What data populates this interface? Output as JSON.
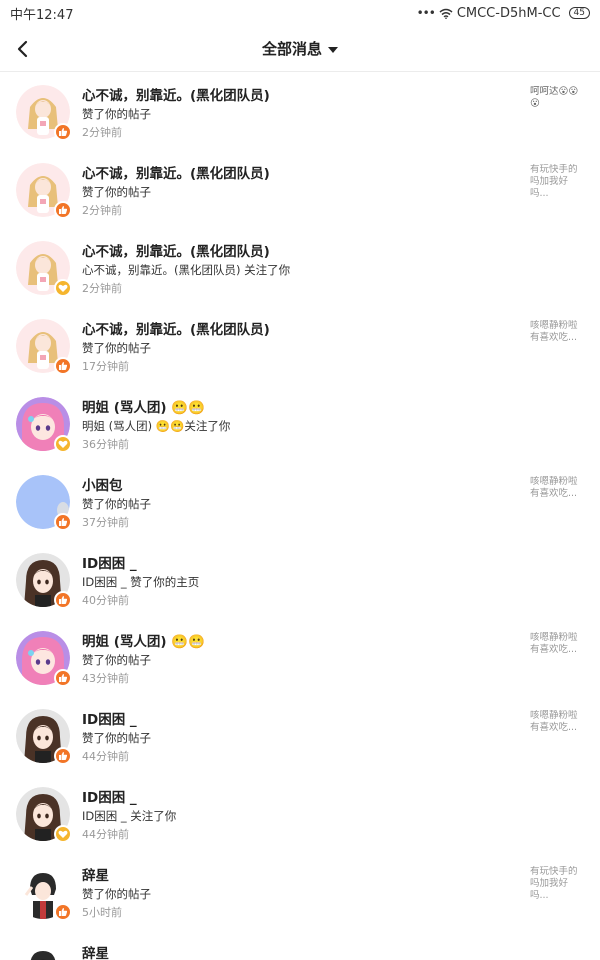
{
  "status_bar": {
    "time": "中午12:47",
    "carrier": "CMCC-D5hM-CC",
    "battery": "45"
  },
  "header": {
    "title": "全部消息"
  },
  "notifications": [
    {
      "name": "心不诚，别靠近。(黑化团队员)",
      "action": "赞了你的帖子",
      "time": "2分钟前",
      "preview": "呵呵达😮😮😮",
      "badge": "like",
      "avatar": "anime-girl-blonde"
    },
    {
      "name": "心不诚，别靠近。(黑化团队员)",
      "action": "赞了你的帖子",
      "time": "2分钟前",
      "preview": "有玩快手的吗加我好吗...",
      "badge": "like",
      "avatar": "anime-girl-blonde"
    },
    {
      "name": "心不诚，别靠近。(黑化团队员)",
      "action": "心不诚，别靠近。(黑化团队员) 关注了你",
      "time": "2分钟前",
      "preview": "",
      "badge": "follow",
      "avatar": "anime-girl-blonde"
    },
    {
      "name": "心不诚，别靠近。(黑化团队员)",
      "action": "赞了你的帖子",
      "time": "17分钟前",
      "preview": "咳嗯静粉啦有喜欢吃...",
      "badge": "like",
      "avatar": "anime-girl-blonde"
    },
    {
      "name": "明姐 (骂人团) 😬😬",
      "action": "明姐 (骂人团) 😬😬关注了你",
      "time": "36分钟前",
      "preview": "",
      "badge": "follow",
      "avatar": "anime-girl-pink"
    },
    {
      "name": "小困包",
      "action": "赞了你的帖子",
      "time": "37分钟前",
      "preview": "咳嗯静粉啦有喜欢吃...",
      "badge": "like",
      "avatar": "blue-circle"
    },
    {
      "name": "ID困困 _",
      "action": "ID困困 _ 赞了你的主页",
      "time": "40分钟前",
      "preview": "",
      "badge": "like",
      "avatar": "anime-girl-brown"
    },
    {
      "name": "明姐 (骂人团) 😬😬",
      "action": "赞了你的帖子",
      "time": "43分钟前",
      "preview": "咳嗯静粉啦有喜欢吃...",
      "badge": "like",
      "avatar": "anime-girl-pink"
    },
    {
      "name": "ID困困 _",
      "action": "赞了你的帖子",
      "time": "44分钟前",
      "preview": "咳嗯静粉啦有喜欢吃...",
      "badge": "like",
      "avatar": "anime-girl-brown"
    },
    {
      "name": "ID困困 _",
      "action": "ID困困 _ 关注了你",
      "time": "44分钟前",
      "preview": "",
      "badge": "follow",
      "avatar": "anime-girl-brown"
    },
    {
      "name": "辞星",
      "action": "赞了你的帖子",
      "time": "5小时前",
      "preview": "有玩快手的吗加我好吗...",
      "badge": "like",
      "avatar": "anime-boy-dark"
    },
    {
      "name": "辞星",
      "action": "",
      "time": "",
      "preview": "",
      "badge": "",
      "avatar": "anime-boy-dark"
    }
  ],
  "colors": {
    "like_badge": "#f27527",
    "follow_badge": "#f5b52e",
    "time_text": "#999999"
  }
}
